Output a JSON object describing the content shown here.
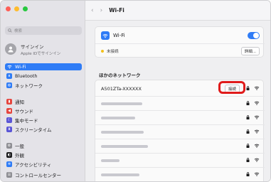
{
  "search": {
    "placeholder": "検索"
  },
  "account": {
    "name": "サインイン",
    "subtitle": "Apple IDでサインイン"
  },
  "sidebar": {
    "items": [
      {
        "label": "Wi-Fi",
        "icon": "wifi-icon",
        "color": "#2f7cf6"
      },
      {
        "label": "Bluetooth",
        "icon": "bluetooth-icon",
        "color": "#2f7cf6"
      },
      {
        "label": "ネットワーク",
        "icon": "globe-icon",
        "color": "#2f7cf6"
      },
      {
        "label": "通知",
        "icon": "bell-icon",
        "color": "#e5463f"
      },
      {
        "label": "サウンド",
        "icon": "speaker-icon",
        "color": "#e5463f"
      },
      {
        "label": "集中モード",
        "icon": "moon-icon",
        "color": "#5a55d6"
      },
      {
        "label": "スクリーンタイム",
        "icon": "hourglass-icon",
        "color": "#5a55d6"
      },
      {
        "label": "一般",
        "icon": "gear-icon",
        "color": "#8e8e93"
      },
      {
        "label": "外観",
        "icon": "appearance-icon",
        "color": "#1d1d1f"
      },
      {
        "label": "アクセシビリティ",
        "icon": "accessibility-icon",
        "color": "#2f7cf6"
      },
      {
        "label": "コントロールセンター",
        "icon": "control-center-icon",
        "color": "#8e8e93"
      }
    ]
  },
  "header": {
    "title": "Wi-Fi"
  },
  "wifi": {
    "label": "Wi-Fi",
    "enabled": true,
    "status": "未接続",
    "status_color": "#f2c01b",
    "details_label": "詳細..."
  },
  "other_networks": {
    "heading": "ほかのネットワーク",
    "first_network": "A501ZTa-XXXXXX",
    "connect_label": "接続"
  },
  "highlight_color": "#e01b1b"
}
